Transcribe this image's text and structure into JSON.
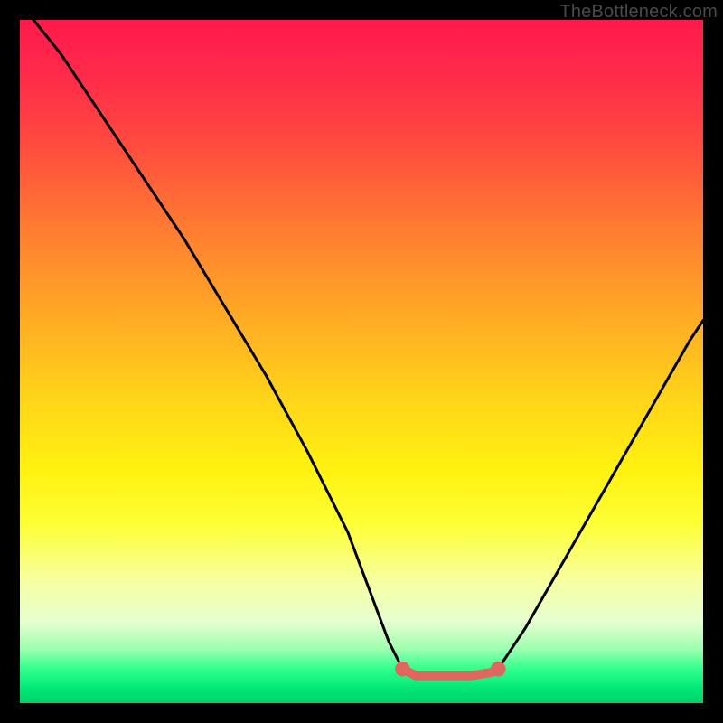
{
  "watermark": "TheBottleneck.com",
  "chart_data": {
    "type": "line",
    "title": "",
    "xlabel": "",
    "ylabel": "",
    "xlim": [
      0,
      100
    ],
    "ylim": [
      0,
      100
    ],
    "grid": false,
    "series": [
      {
        "name": "curve-left",
        "color": "#000000",
        "x": [
          2,
          6,
          12,
          18,
          24,
          30,
          36,
          42,
          48,
          54,
          56
        ],
        "values": [
          100,
          95,
          86,
          77,
          68,
          58,
          48,
          37,
          25,
          9,
          5
        ]
      },
      {
        "name": "curve-right",
        "color": "#000000",
        "x": [
          70,
          74,
          78,
          82,
          86,
          90,
          94,
          98,
          100
        ],
        "values": [
          5,
          11,
          18,
          25,
          32,
          39,
          46,
          53,
          56
        ]
      },
      {
        "name": "flat-bottom",
        "color": "#e06660",
        "x": [
          56,
          58,
          66,
          69,
          70
        ],
        "values": [
          5,
          4,
          4,
          4.5,
          5
        ]
      }
    ],
    "markers": [
      {
        "name": "dot-left",
        "x": 56,
        "y": 5,
        "r": 1.1,
        "color": "#e06660"
      },
      {
        "name": "dot-right",
        "x": 70,
        "y": 5,
        "r": 1.1,
        "color": "#e06660"
      }
    ]
  }
}
